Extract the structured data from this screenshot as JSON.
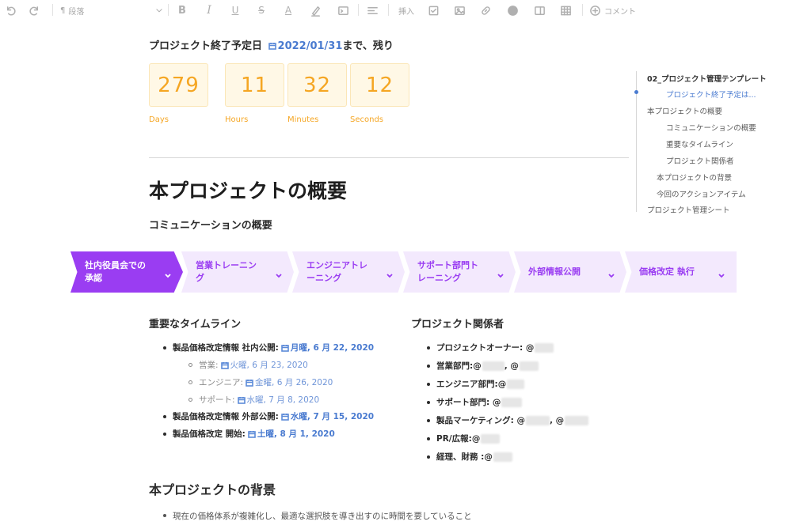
{
  "toolbar": {
    "paragraph_label": "段落",
    "insert_label": "挿入",
    "comment_label": "コメント",
    "pilcrow": "¶",
    "bold": "B",
    "italic": "I",
    "underline": "U",
    "strike": "S",
    "font_color": "A"
  },
  "countdown": {
    "title_prefix": "プロジェクト終了予定日 ",
    "date": "2022/01/31",
    "title_suffix": "まで、残り",
    "units": [
      {
        "value": "279",
        "label": "Days"
      },
      {
        "value": "11",
        "label": "Hours"
      },
      {
        "value": "32",
        "label": "Minutes"
      },
      {
        "value": "12",
        "label": "Seconds"
      }
    ]
  },
  "overview": {
    "title": "本プロジェクトの概要",
    "communication_title": "コミュニケーションの概要"
  },
  "process_steps": [
    {
      "label": "社内役員会での\n承認"
    },
    {
      "label": "営業トレーニン\nグ"
    },
    {
      "label": "エンジニアトレ\nーニング"
    },
    {
      "label": "サポート部門ト\nレーニング"
    },
    {
      "label": "外部情報公開"
    },
    {
      "label": "価格改定 執行"
    }
  ],
  "timeline": {
    "title": "重要なタイムライン",
    "items": [
      {
        "text": "製品価格改定情報 社内公開: ",
        "date": "月曜, 6 月 22, 2020",
        "level": 1
      },
      {
        "text": "営業:",
        "date": "火曜, 6 月 23, 2020",
        "level": 2
      },
      {
        "text": "エンジニア:",
        "date": "金曜, 6 月 26, 2020",
        "level": 2
      },
      {
        "text": "サポート:",
        "date": "水曜, 7 月 8, 2020",
        "level": 2
      },
      {
        "text": "製品価格改定情報 外部公開: ",
        "date": "水曜, 7 月 15, 2020",
        "level": 1
      },
      {
        "text": "製品価格改定 開始:",
        "date": "土曜, 8 月 1, 2020",
        "level": 1
      }
    ]
  },
  "stakeholders": {
    "title": "プロジェクト関係者",
    "items": [
      {
        "text": "プロジェクトオーナー: @"
      },
      {
        "text": "営業部門:@",
        "second": ", @"
      },
      {
        "text": "エンジニア部門:@"
      },
      {
        "text": "サポート部門: @"
      },
      {
        "text": "製品マーケティング: @",
        "second": ", @"
      },
      {
        "text": "PR/広報:@"
      },
      {
        "text": "経理、財務 :@"
      }
    ]
  },
  "background": {
    "title": "本プロジェクトの背景",
    "first_item": "現在の価格体系が複雑化し、最適な選択肢を導き出すのに時間を要していること"
  },
  "toc": {
    "items": [
      {
        "label": "02_プロジェクト管理テンプレート",
        "state": "top"
      },
      {
        "label": "プロジェクト終了予定は...",
        "state": "active"
      },
      {
        "label": "本プロジェクトの概要",
        "state": "normal"
      },
      {
        "label": "コミュニケーションの概要",
        "state": "normal"
      },
      {
        "label": "重要なタイムライン",
        "state": "normal"
      },
      {
        "label": "プロジェクト関係者",
        "state": "normal"
      },
      {
        "label": "本プロジェクトの背景",
        "state": "normal"
      },
      {
        "label": "今回のアクションアイテム",
        "state": "normal"
      },
      {
        "label": "プロジェクト管理シート",
        "state": "normal"
      }
    ]
  },
  "colors": {
    "accent_purple": "#9a3df2",
    "step_bg": "#f3e9fd",
    "timer_orange": "#f5a623",
    "link_blue": "#4a7bd0"
  }
}
